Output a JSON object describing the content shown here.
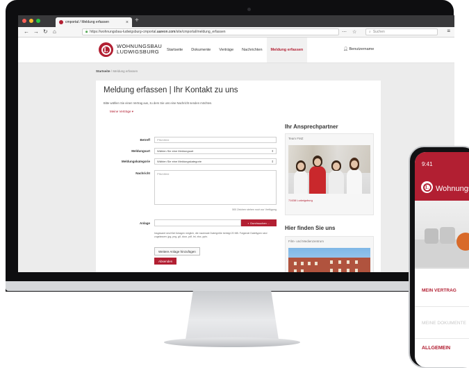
{
  "browser": {
    "tab_title": "cmportal / Meldung erfassen",
    "url_prefix": "https://wohnungsbau-ludwigsburg-cmportal.",
    "url_host": "aareon.com",
    "url_suffix": "/site/cmportal/meldung_erfassen",
    "search_placeholder": "Suchen"
  },
  "site": {
    "logo_line1": "WOHNUNGSBAU",
    "logo_line2": "LUDWIGSBURG",
    "nav": [
      "Startseite",
      "Dokumente",
      "Verträge",
      "Nachrichten",
      "Meldung erfassen"
    ],
    "user": "Benutzername"
  },
  "breadcrumb": {
    "home": "Startseite",
    "separator": "/",
    "current": "Meldung erfassen"
  },
  "form": {
    "title": "Meldung erfassen | Ihr Kontakt zu uns",
    "intro": "Bitte wählen Sie einen Vertrag aus, zu dem Sie uns eine Nachricht senden möchten.",
    "my_contracts": "Meine Verträge",
    "subject_label": "Betreff",
    "subject_placeholder": "Pflichtfeld",
    "type_label": "Meldungsart",
    "type_value": "Wählen Sie eine Meldungsart",
    "category_label": "Meldungskategorie",
    "category_value": "Wählen Sie eine Meldungskategorie",
    "message_label": "Nachricht",
    "message_placeholder": "Pflichtfeld",
    "char_hint": "500 Zeichen stehen noch zur Verfügung",
    "attachment_label": "Anlage",
    "browse_label": "Durchsuchen ...",
    "attachment_info": "Insgesamt sind fünf Anlagen möglich, die maximale Dateigröße beträgt 20 MB. Folgende Dateitypen sind zugelassen: jpg, png, gif, docx, pdf, txt, xlsx, pptx.",
    "more_attachment": "Weitere Anlage hinzufügen",
    "send": "Absenden"
  },
  "aside": {
    "contact_heading": "Ihr Ansprechpartner",
    "team_title": "Team FMZ",
    "team_location": "71638 Ludwigsburg",
    "find_heading": "Hier finden Sie uns",
    "place_title": "Film- und Medienzentrum"
  },
  "phone": {
    "time": "9:41",
    "brand": "Wohnungsbau",
    "menu": [
      "MEIN VERTRAG",
      "MEINE DOKUMENTE",
      "ALLGEMEIN"
    ]
  }
}
